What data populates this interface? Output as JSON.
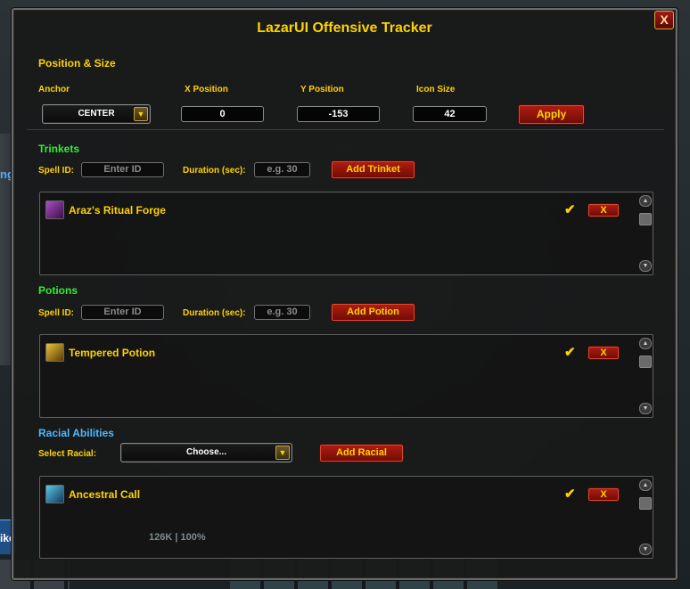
{
  "window": {
    "title": "LazarUI Offensive Tracker",
    "close_label": "X"
  },
  "position_size": {
    "title": "Position & Size",
    "anchor_label": "Anchor",
    "anchor_value": "CENTER",
    "x_label": "X Position",
    "x_value": "0",
    "y_label": "Y Position",
    "y_value": "-153",
    "icon_label": "Icon Size",
    "icon_value": "42",
    "apply_label": "Apply"
  },
  "trinkets": {
    "title": "Trinkets",
    "spell_label": "Spell ID:",
    "spell_placeholder": "Enter ID",
    "duration_label": "Duration (sec):",
    "duration_placeholder": "e.g. 30",
    "add_label": "Add Trinket",
    "items": [
      {
        "name": "Araz's Ritual Forge",
        "checked": true,
        "remove_label": "X",
        "icon": "ritual-forge-icon",
        "icon_color": "#7a2a8a"
      }
    ]
  },
  "potions": {
    "title": "Potions",
    "spell_label": "Spell ID:",
    "spell_placeholder": "Enter ID",
    "duration_label": "Duration (sec):",
    "duration_placeholder": "e.g. 30",
    "add_label": "Add Potion",
    "items": [
      {
        "name": "Tempered Potion",
        "checked": true,
        "remove_label": "X",
        "icon": "potion-icon",
        "icon_color": "#c9a326"
      }
    ]
  },
  "racials": {
    "title": "Racial Abilities",
    "select_label": "Select Racial:",
    "select_value": "Choose...",
    "add_label": "Add Racial",
    "items": [
      {
        "name": "Ancestral Call",
        "checked": true,
        "remove_label": "X",
        "icon": "ancestral-call-icon",
        "icon_color": "#2a8ab8"
      }
    ]
  },
  "background": {
    "side_text": "ng",
    "unitframe_text": "ike",
    "health_text": "126K | 100%"
  }
}
